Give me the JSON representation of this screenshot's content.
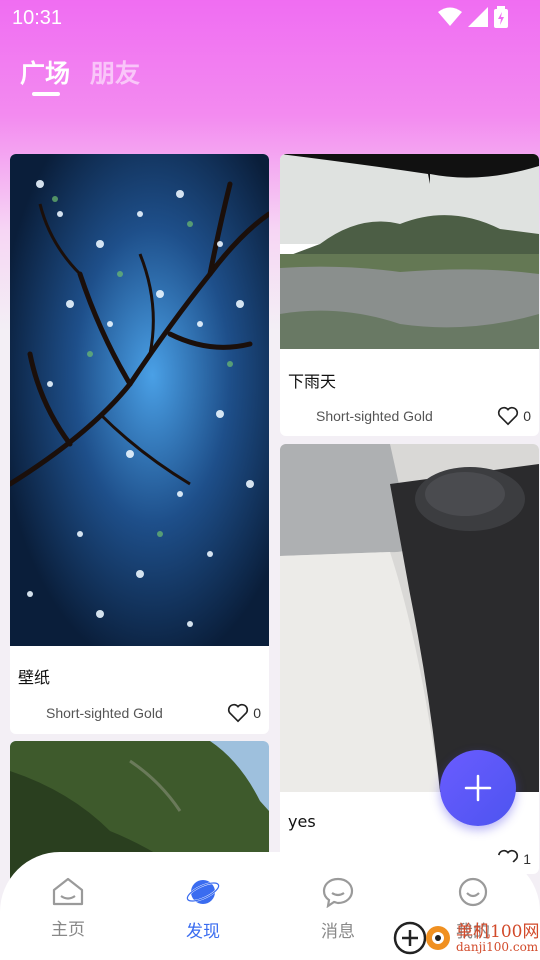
{
  "status_bar": {
    "time": "10:31"
  },
  "tabs": [
    {
      "label": "广场",
      "active": true
    },
    {
      "label": "朋友",
      "active": false
    }
  ],
  "posts": [
    {
      "title": "壁纸",
      "author": "Short-sighted Gold",
      "likes": "0"
    },
    {
      "title": "下雨天",
      "author": "Short-sighted Gold",
      "likes": "0"
    },
    {
      "title": "yes",
      "author": "",
      "likes": "1"
    }
  ],
  "bottom_nav": {
    "items": [
      {
        "label": "主页",
        "icon": "home-icon",
        "active": false
      },
      {
        "label": "发现",
        "icon": "planet-icon",
        "active": true
      },
      {
        "label": "消息",
        "icon": "message-icon",
        "active": false
      },
      {
        "label": "我的",
        "icon": "smile-icon",
        "active": false
      }
    ]
  },
  "fab": {
    "icon": "plus-icon"
  },
  "watermark": {
    "title": "单机100网",
    "url": "danji100.com"
  },
  "colors": {
    "accent": "#3a6cf0",
    "fab": "#5a55f5",
    "header": "#f06df2"
  }
}
